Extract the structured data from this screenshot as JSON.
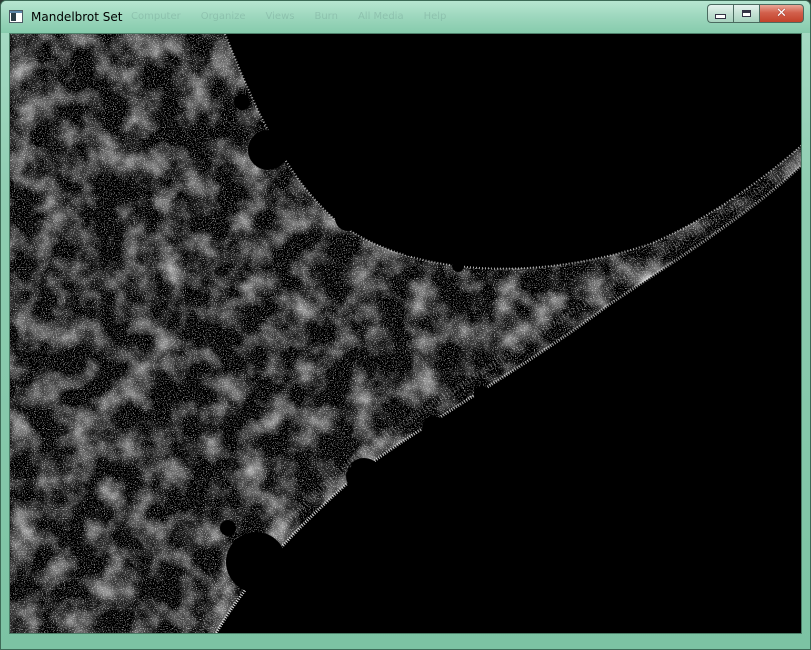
{
  "window": {
    "title": "Mandelbrot Set",
    "background_color": "#000000",
    "frame_color": "#8fcdb1",
    "icon": "app-window-icon",
    "ghost_menu": [
      "Computer",
      "Organize",
      "Views",
      "Burn",
      "All Media",
      "Help"
    ]
  },
  "caption_buttons": {
    "minimize_icon": "minimize-icon",
    "maximize_icon": "maximize-icon",
    "close_icon": "close-icon",
    "close_glyph": "✕",
    "close_color": "#c7432c"
  }
}
